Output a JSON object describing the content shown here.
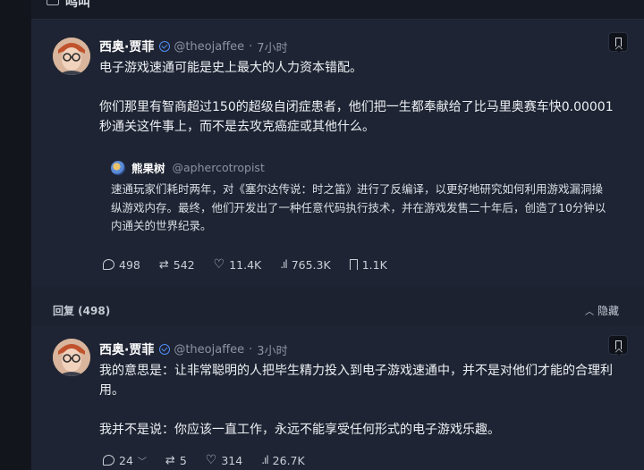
{
  "top": {
    "label": "鸣叫"
  },
  "main_post": {
    "author_name": "西奥·贾菲",
    "handle": "@theojaffee",
    "separator": "·",
    "time": "7小时",
    "paragraphs": [
      "电子游戏速通可能是史上最大的人力资本错配。",
      "你们那里有智商超过150的超级自闭症患者，他们把一生都奉献给了比马里奥赛车快0.00001秒通关这件事上，而不是去攻克癌症或其他什么。"
    ],
    "quote": {
      "author_name": "熊果树",
      "handle": "@aphercotropist",
      "text": "速通玩家们耗时两年，对《塞尔达传说：时之笛》进行了反编译，以更好地研究如何利用游戏漏洞操纵游戏内存。最终，他们开发出了一种任意代码执行技术，并在游戏发售二十年后，创造了10分钟以内通关的世界纪录。"
    },
    "stats": {
      "replies": "498",
      "retweets": "542",
      "likes": "11.4K",
      "views": "765.3K",
      "bookmarks": "1.1K"
    }
  },
  "replies_section": {
    "title": "回复 (498)",
    "hide_label": "隐藏"
  },
  "reply_post": {
    "author_name": "西奥·贾菲",
    "handle": "@theojaffee",
    "separator": "·",
    "time": "3小时",
    "paragraphs": [
      "我的意思是：让非常聪明的人把毕生精力投入到电子游戏速通中，并不是对他们才能的合理利用。",
      "我并不是说：你应该一直工作，永远不能享受任何形式的电子游戏乐趣。"
    ],
    "stats": {
      "replies": "24",
      "retweets": "5",
      "likes": "314",
      "views": "26.7K"
    }
  },
  "colors": {
    "panel_bg": "#1e2433",
    "page_bg": "#13161d",
    "verified": "#4f8ef7",
    "muted_text": "#8b93a3"
  },
  "icons": [
    "chat-icon",
    "verified-icon",
    "bookmark-icon",
    "reply-icon",
    "retweet-icon",
    "like-icon",
    "views-icon",
    "chevron-down-icon",
    "chevron-up-icon"
  ]
}
